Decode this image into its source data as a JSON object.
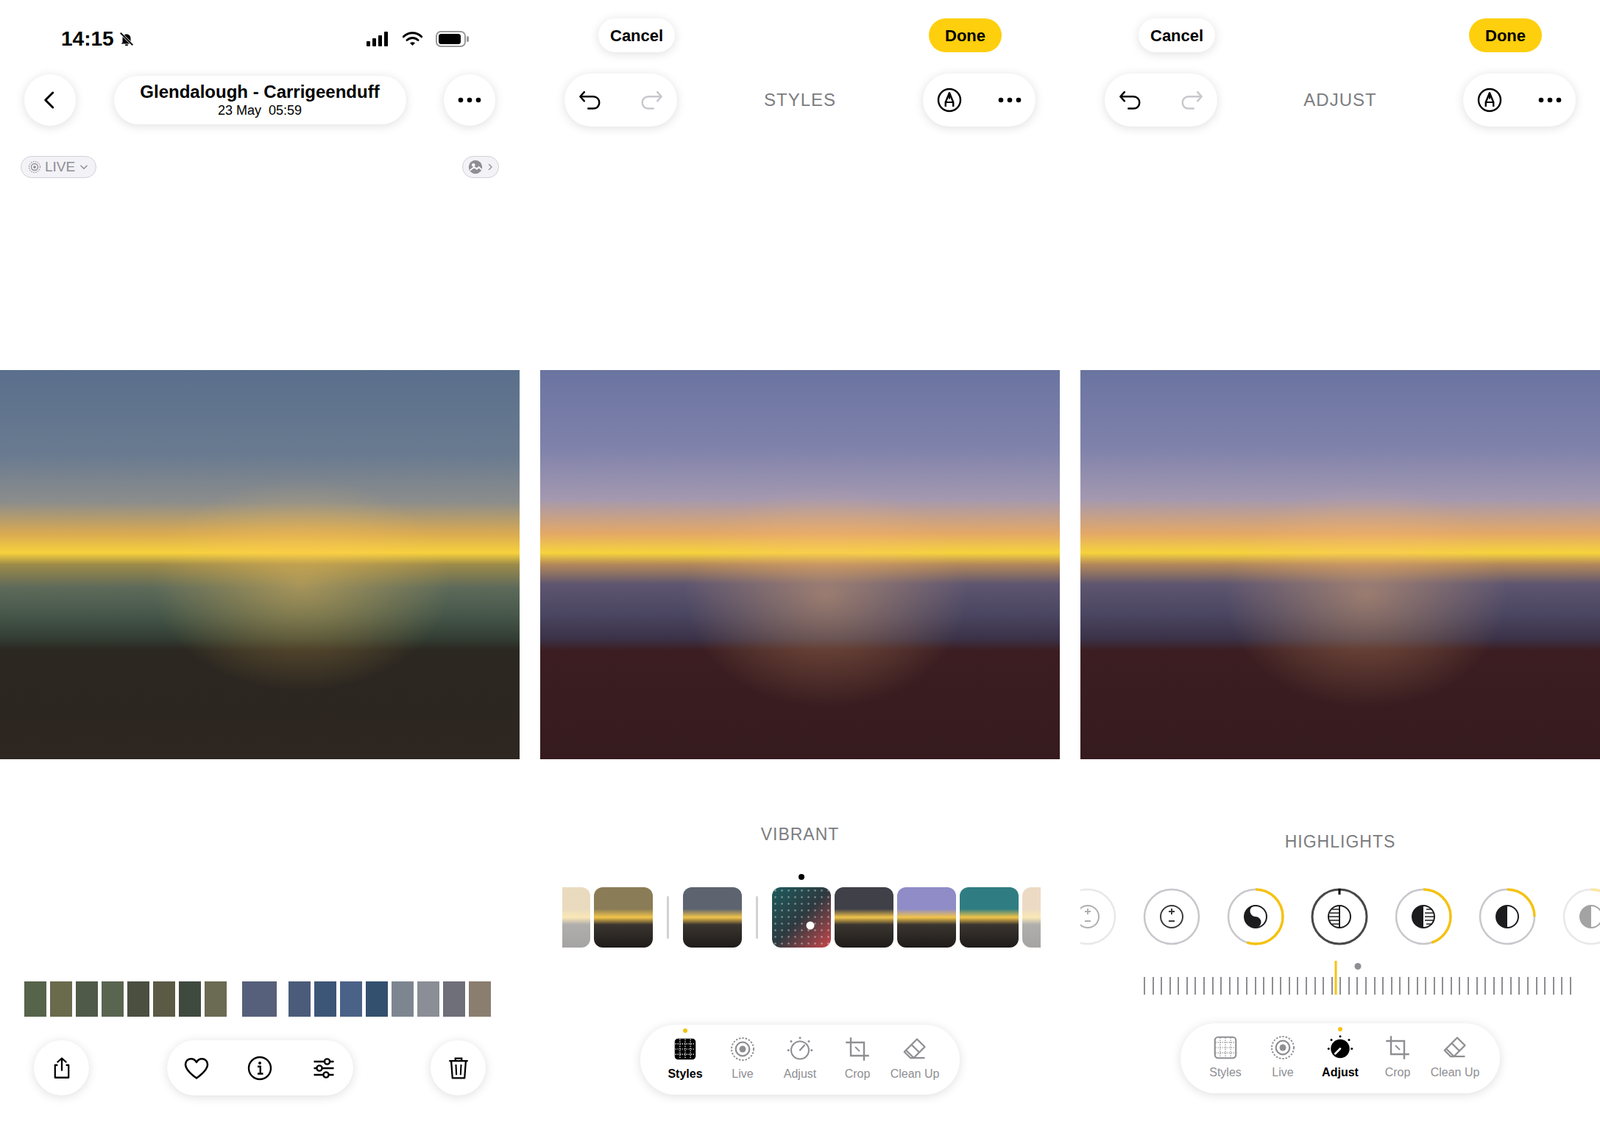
{
  "viewer": {
    "status_bar": {
      "time": "14:15",
      "silent": true
    },
    "title": "Glendalough - Carrigeenduff",
    "subtitle": "23 May  05:59",
    "live_badge": "LIVE",
    "favorite": false,
    "filmstrip": [
      {
        "selected": false
      },
      {
        "selected": false
      },
      {
        "selected": false
      },
      {
        "selected": false
      },
      {
        "selected": false
      },
      {
        "selected": false
      },
      {
        "selected": false
      },
      {
        "selected": false
      },
      {
        "selected": true
      },
      {
        "selected": false
      },
      {
        "selected": false
      },
      {
        "selected": false
      },
      {
        "selected": false
      },
      {
        "selected": false
      },
      {
        "selected": false
      },
      {
        "selected": false
      },
      {
        "selected": false
      }
    ]
  },
  "editors": [
    {
      "kind": "styles",
      "cancel": "Cancel",
      "done": "Done",
      "mode": "STYLES",
      "option_label": "VIBRANT",
      "styles": [
        {
          "kind": "photo",
          "group": 0,
          "color": "#c9a45e",
          "selected": false
        },
        {
          "kind": "photo",
          "group": 0,
          "color": "#8a7c56",
          "selected": false
        },
        {
          "kind": "photo",
          "group": 1,
          "color": "#5d6470",
          "selected": false
        },
        {
          "kind": "pad",
          "group": 2,
          "color": "#c8474a",
          "selected": true,
          "level_x": 0.65,
          "level_y": 0.64
        },
        {
          "kind": "photo",
          "group": 2,
          "color": "#3f4048",
          "selected": false
        },
        {
          "kind": "photo",
          "group": 2,
          "color": "#8f8cc8",
          "selected": false
        },
        {
          "kind": "photo",
          "group": 2,
          "color": "#2f7d82",
          "selected": false
        },
        {
          "kind": "photo",
          "group": 2,
          "color": "#d2a36c",
          "selected": false
        }
      ],
      "tools": [
        {
          "label": "Styles",
          "selected": true
        },
        {
          "label": "Live",
          "selected": false
        },
        {
          "label": "Adjust",
          "selected": false
        },
        {
          "label": "Crop",
          "selected": false
        },
        {
          "label": "Clean Up",
          "selected": false
        }
      ]
    },
    {
      "kind": "adjust",
      "cancel": "Cancel",
      "done": "Done",
      "mode": "ADJUST",
      "option_label": "HIGHLIGHTS",
      "knobs": [
        {
          "selected": false,
          "level": 0
        },
        {
          "selected": false,
          "level": 0
        },
        {
          "selected": false,
          "level": 0.55
        },
        {
          "selected": true,
          "level": 0
        },
        {
          "selected": false,
          "level": 0.45
        },
        {
          "selected": false,
          "level": 0.25
        },
        {
          "selected": false,
          "level": 0.1
        }
      ],
      "slider": {
        "level": 0.45,
        "default_level": 0.5
      },
      "tools": [
        {
          "label": "Styles",
          "selected": false
        },
        {
          "label": "Live",
          "selected": false
        },
        {
          "label": "Adjust",
          "selected": true
        },
        {
          "label": "Crop",
          "selected": false
        },
        {
          "label": "Clean Up",
          "selected": false
        }
      ]
    }
  ]
}
